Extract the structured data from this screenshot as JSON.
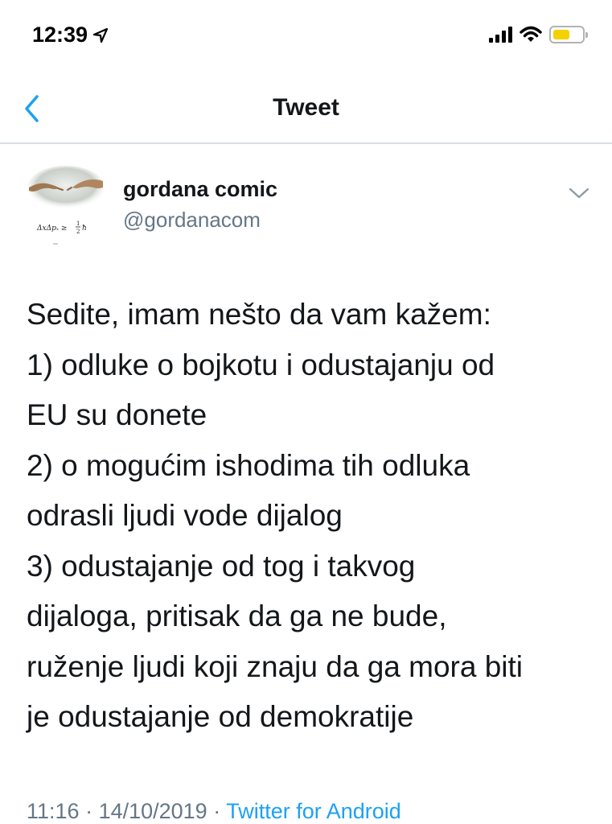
{
  "status_bar": {
    "time": "12:39",
    "location_icon": "location-arrow-icon",
    "signal_icon": "cellular-signal-icon",
    "wifi_icon": "wifi-icon",
    "battery_icon": "battery-icon",
    "battery_color": "#f5d100"
  },
  "nav": {
    "back_icon": "chevron-left-icon",
    "title": "Tweet",
    "accent_color": "#1da1f2"
  },
  "tweet": {
    "author_name": "gordana comic",
    "author_handle": "@gordanacom",
    "avatar_caption": "ΔxΔpₓ ≥ ½ħ",
    "more_icon": "chevron-down-icon",
    "lines": [
      "Sedite, imam nešto da vam kažem:",
      "1) odluke o bojkotu i odustajanju od",
      "EU su donete",
      "2) o mogućim ishodima tih odluka",
      "odrasli ljudi vode dijalog",
      "3) odustajanje od tog i takvog",
      "dijaloga, pritisak da ga ne bude,",
      "ruženje ljudi koji znaju da ga mora biti",
      "je odustajanje od demokratije"
    ],
    "time": "11:16",
    "separator": " · ",
    "date": "14/10/2019",
    "source": "Twitter for Android"
  }
}
